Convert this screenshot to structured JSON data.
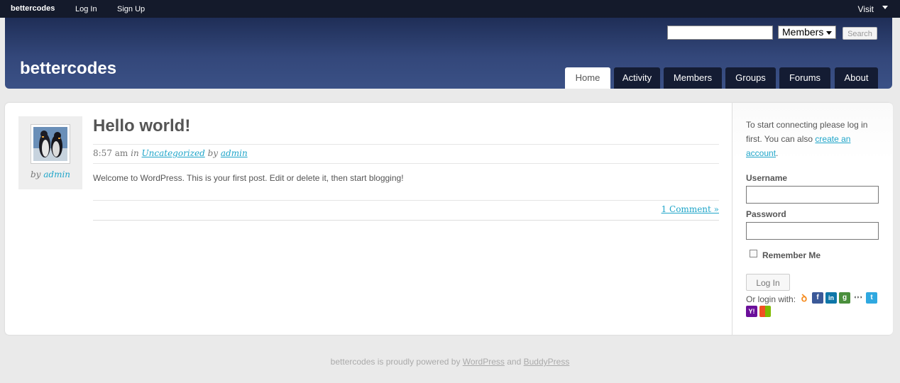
{
  "adminbar": {
    "brand": "bettercodes",
    "login": "Log In",
    "signup": "Sign Up",
    "visit": "Visit"
  },
  "header": {
    "site_title": "bettercodes",
    "search_placeholder": "",
    "search_scope": "Members",
    "search_button": "Search",
    "nav": [
      {
        "label": "Home",
        "active": true
      },
      {
        "label": "Activity"
      },
      {
        "label": "Members"
      },
      {
        "label": "Groups"
      },
      {
        "label": "Forums"
      },
      {
        "label": "About"
      }
    ]
  },
  "post": {
    "by": "by",
    "author": "admin",
    "title": "Hello world!",
    "time": "8:57 am",
    "in": "in",
    "category": "Uncategorized",
    "by2": "by",
    "body": "Welcome to WordPress. This is your first post. Edit or delete it, then start blogging!",
    "comments": "1 Comment »"
  },
  "sidebar": {
    "intro": "To start connecting please log in first. You can also ",
    "create_account": "create an account",
    "intro_end": ".",
    "username_label": "Username",
    "password_label": "Password",
    "remember_label": "Remember Me",
    "login_button": "Log In",
    "or_login": "Or login with:",
    "providers": [
      "openid-icon",
      "facebook-icon",
      "linkedin-icon",
      "google-icon",
      "myspace-icon",
      "twitter-icon",
      "yahoo-icon",
      "windows-icon"
    ]
  },
  "footer": {
    "pre": "bettercodes is proudly powered by ",
    "wordpress": "WordPress",
    "and": " and ",
    "buddypress": "BuddyPress"
  },
  "colors": {
    "header_top": "#1f2e57",
    "header_bottom": "#3b5186",
    "nav_tab": "#141c33",
    "link": "#1fa5c9"
  }
}
